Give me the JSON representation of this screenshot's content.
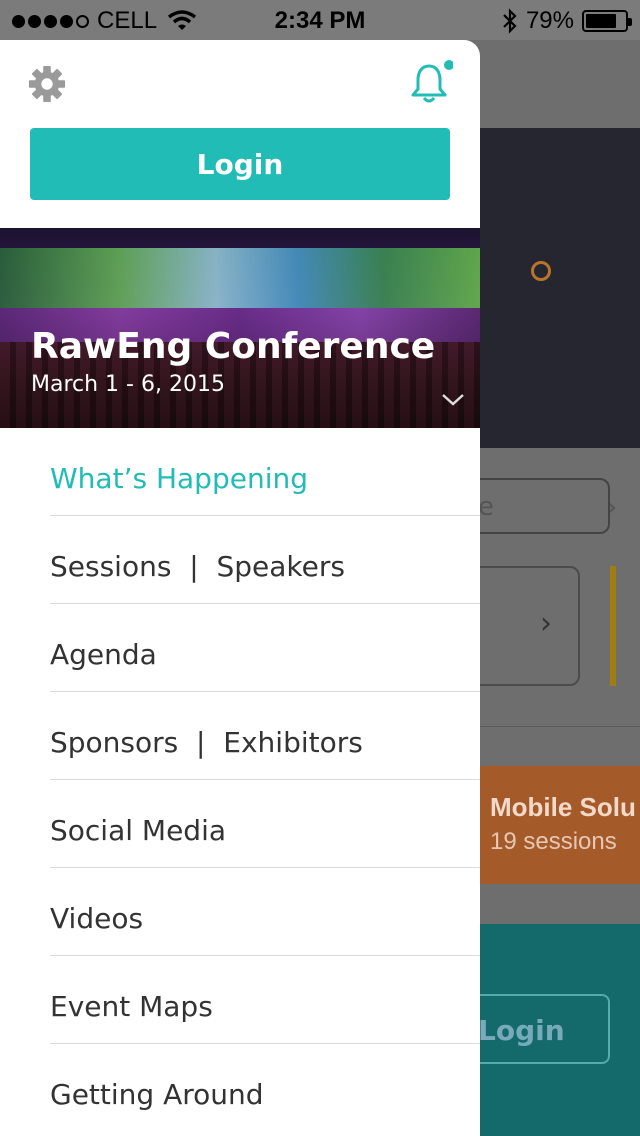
{
  "status_bar": {
    "carrier": "CELL",
    "time": "2:34 PM",
    "battery": "79%",
    "battery_level": 0.79
  },
  "drawer": {
    "login_label": "Login",
    "notification_dot_color": "#22bcb6",
    "event": {
      "title": "RawEng Conference",
      "dates": "March 1 - 6, 2015"
    },
    "menu": [
      {
        "label": "What’s Happening",
        "active": true
      },
      {
        "label": "Sessions  |  Speakers"
      },
      {
        "label": "Agenda"
      },
      {
        "label": "Sponsors  |  Exhibitors"
      },
      {
        "label": "Social Media"
      },
      {
        "label": "Videos"
      },
      {
        "label": "Event Maps"
      },
      {
        "label": "Getting Around"
      }
    ]
  },
  "background_app": {
    "track_title": "Mobile Solu",
    "track_count": "19 sessions",
    "login_label": "Login"
  },
  "colors": {
    "accent": "#22bcb6",
    "menu_text": "#333333"
  }
}
